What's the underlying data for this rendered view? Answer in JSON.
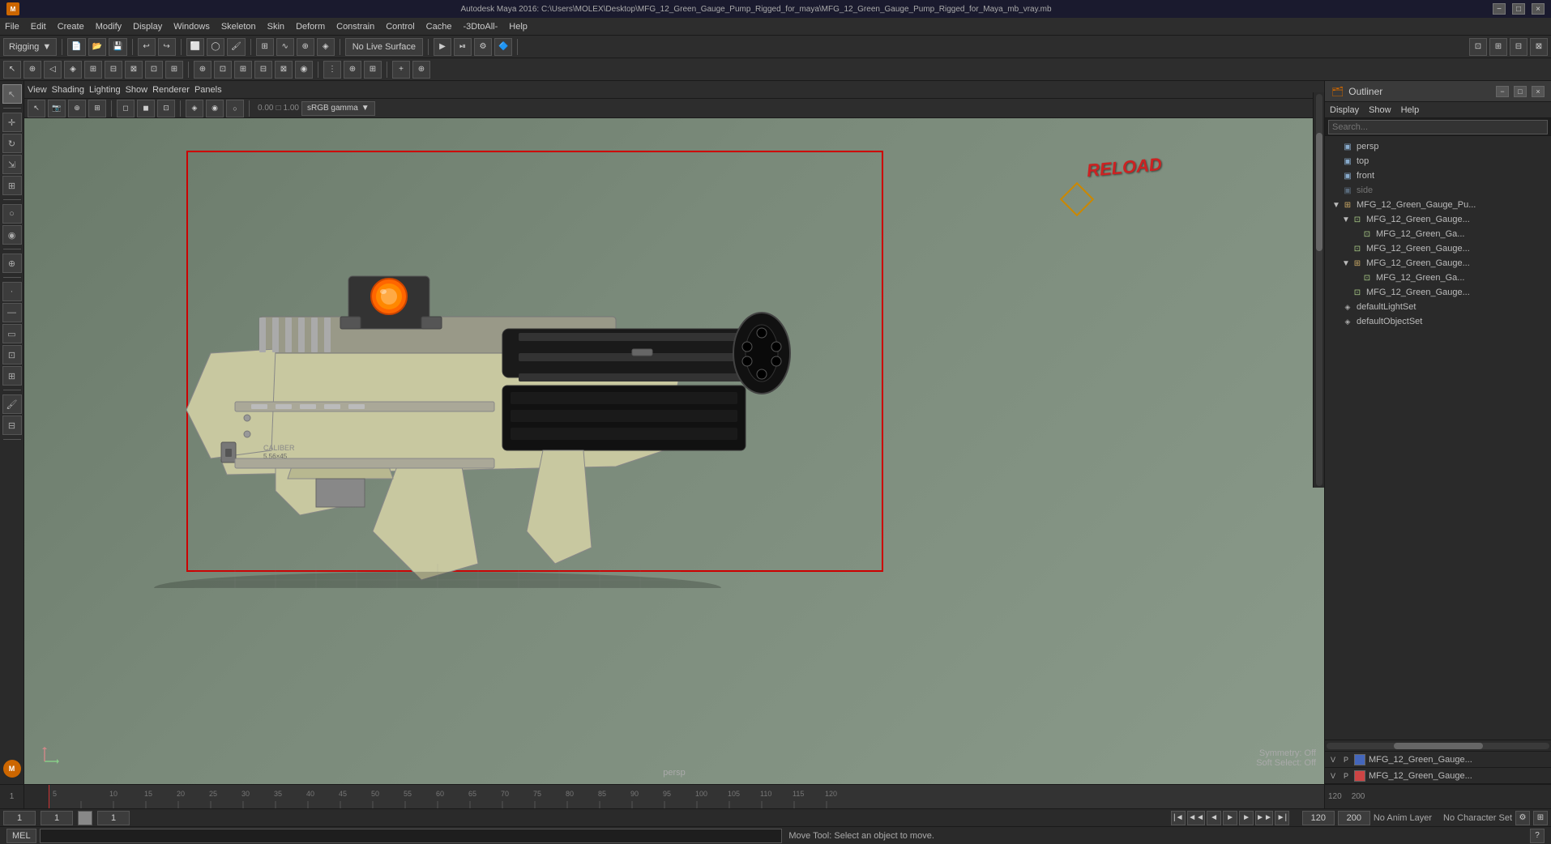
{
  "titlebar": {
    "title": "Autodesk Maya 2016: C:\\Users\\MOLEX\\Desktop\\MFG_12_Green_Gauge_Pump_Rigged_for_maya\\MFG_12_Green_Gauge_Pump_Rigged_for_Maya_mb_vray.mb",
    "minimize": "−",
    "maximize": "□",
    "close": "×"
  },
  "menubar": {
    "items": [
      "File",
      "Edit",
      "Create",
      "Modify",
      "Display",
      "Windows",
      "Skeleton",
      "Skin",
      "Deform",
      "Constrain",
      "Control",
      "Cache",
      "-3DtoAll-",
      "Help"
    ]
  },
  "toolbar1": {
    "mode_dropdown": "Rigging",
    "no_live_surface": "No Live Surface"
  },
  "viewport": {
    "menus": [
      "View",
      "Shading",
      "Lighting",
      "Show",
      "Renderer",
      "Panels"
    ],
    "camera_label": "persp",
    "value1": "0.00",
    "value2": "1.00",
    "color_profile": "sRGB gamma",
    "reload_text": "RELOAD",
    "symmetry_label": "Symmetry:",
    "symmetry_value": "Off",
    "soft_select_label": "Soft Select:",
    "soft_select_value": "Off"
  },
  "outliner": {
    "title": "Outliner",
    "menus": [
      "Display",
      "Show",
      "Help"
    ],
    "tree_items": [
      {
        "name": "persp",
        "type": "camera",
        "indent": 0,
        "arrow": ""
      },
      {
        "name": "top",
        "type": "camera",
        "indent": 0,
        "arrow": ""
      },
      {
        "name": "front",
        "type": "camera",
        "indent": 0,
        "arrow": ""
      },
      {
        "name": "side",
        "type": "camera",
        "indent": 0,
        "arrow": "",
        "dimmed": true
      },
      {
        "name": "MFG_12_Green_Gauge_Pu...",
        "type": "group",
        "indent": 0,
        "arrow": "▼"
      },
      {
        "name": "MFG_12_Green_Gauge...",
        "type": "mesh",
        "indent": 1,
        "arrow": "▼"
      },
      {
        "name": "MFG_12_Green_Ga...",
        "type": "mesh",
        "indent": 2,
        "arrow": ""
      },
      {
        "name": "MFG_12_Green_Gauge...",
        "type": "mesh",
        "indent": 1,
        "arrow": ""
      },
      {
        "name": "MFG_12_Green_Gauge...",
        "type": "group",
        "indent": 1,
        "arrow": "▼"
      },
      {
        "name": "MFG_12_Green_Ga...",
        "type": "mesh",
        "indent": 2,
        "arrow": ""
      },
      {
        "name": "MFG_12_Green_Gauge...",
        "type": "mesh",
        "indent": 1,
        "arrow": ""
      },
      {
        "name": "defaultLightSet",
        "type": "set",
        "indent": 0,
        "arrow": ""
      },
      {
        "name": "defaultObjectSet",
        "type": "set",
        "indent": 0,
        "arrow": ""
      }
    ],
    "bottom_rows": [
      {
        "v": "V",
        "p": "P",
        "color": "#4466bb",
        "name": "MFG_12_Green_Gauge..."
      },
      {
        "v": "V",
        "p": "P",
        "color": "#cc4444",
        "name": "MFG_12_Green_Gauge..."
      }
    ]
  },
  "timeline": {
    "start": "1",
    "end": "120",
    "current": "1",
    "range_start": "1",
    "range_end": "120",
    "anim_layer": "No Anim Layer",
    "character_set": "No Character Set"
  },
  "bottom_bar": {
    "mel_label": "MEL"
  },
  "statusbar": {
    "text": "Move Tool: Select an object to move."
  }
}
